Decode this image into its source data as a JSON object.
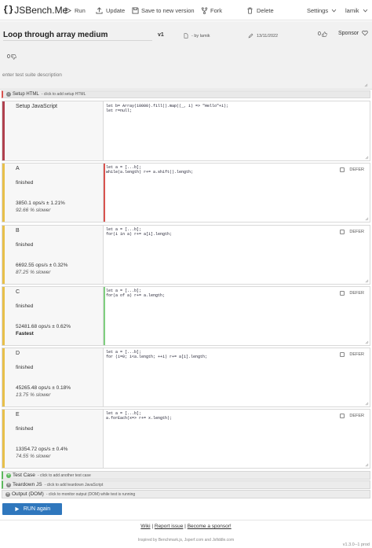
{
  "app": {
    "brand": "JSBench.Me",
    "brace": "{}",
    "toolbar": {
      "run": "Run",
      "update": "Update",
      "save_new": "Save to new version",
      "fork": "Fork",
      "delete": "Delete",
      "settings": "Settings",
      "user": "lamik"
    }
  },
  "suite": {
    "title": "Loop through array medium",
    "version": "v1",
    "by": "- by lamik",
    "date": "13/11/2022",
    "likes": "0",
    "dislikes": "0",
    "sponsor": "Sponsor",
    "description_placeholder": "enter test suite description"
  },
  "setup_html": {
    "label": "Setup HTML",
    "sign": "-",
    "hint": "- click to add setup HTML"
  },
  "setup_js": {
    "label": "Setup JavaScript",
    "code": [
      "let b= Array(10000).fill().map((_, i) => \"Hello\"+i);",
      "let r=null;"
    ]
  },
  "tests": [
    {
      "name": "A",
      "status": "finished",
      "ops": "3850.1 ops/s ± 1.21%",
      "relative": "92.66 % slower",
      "defer": "DEFER",
      "code": [
        "let a = [...b];",
        "while(a.length) r+= a.shift().length;"
      ],
      "accent": "#e8c04a",
      "codemark": "#d9534f"
    },
    {
      "name": "B",
      "status": "finished",
      "ops": "6692.55 ops/s ± 0.32%",
      "relative": "87.25 % slower",
      "defer": "DEFER",
      "code": [
        "let a = [...b];",
        "for(i in a) r+= a[i].length;"
      ],
      "accent": "#e8c04a",
      "codemark": ""
    },
    {
      "name": "C",
      "status": "finished",
      "ops": "52481.68 ops/s ± 0.62%",
      "relative": "Fastest",
      "defer": "DEFER",
      "code": [
        "let a = [...b];",
        "for(a of a) r+= a.length;"
      ],
      "accent": "#e8c04a",
      "codemark": "#7fcf7f"
    },
    {
      "name": "D",
      "status": "finished",
      "ops": "45265.48 ops/s ± 0.18%",
      "relative": "13.75 % slower",
      "defer": "DEFER",
      "code": [
        "let a = [...b];",
        "for (i=0; i<a.length; ++i) r+= a[i].length;"
      ],
      "accent": "#e8c04a",
      "codemark": ""
    },
    {
      "name": "E",
      "status": "finished",
      "ops": "13354.72 ops/s ± 0.4%",
      "relative": "74.55 % slower",
      "defer": "DEFER",
      "code": [
        "let a = [...b];",
        "a.forEach(x=> r+= x.length);"
      ],
      "accent": "#e8c04a",
      "codemark": ""
    }
  ],
  "bottom": {
    "test_case": {
      "sign": "+",
      "label": "Test Case",
      "hint": "- click to add another test case"
    },
    "teardown": {
      "sign": "+",
      "label": "Teardown JS",
      "hint": "- click to add teardown JavaScript"
    },
    "output": {
      "sign": "+",
      "label": "Output (DOM)",
      "hint": "- click to monitor output (DOM) while test is running"
    }
  },
  "run_again": "RUN again",
  "footer": {
    "wiki": "Wiki",
    "report": "Report issue",
    "sponsor": "Become a sponsor!",
    "sep": " | ",
    "inspired": "Inspired by Benchmark.js, Jsperf.com and Jsfiddle.com",
    "version": "v1.3.0--1 prod"
  },
  "colors": {
    "setup_html_accent": "#d9534f",
    "setup_js_accent": "#b0414f",
    "test_accent": "#e8c04a",
    "run_button": "#2f77bd",
    "test_case_sign": "#5cb85c",
    "teardown_accent": "#5cb85c"
  }
}
